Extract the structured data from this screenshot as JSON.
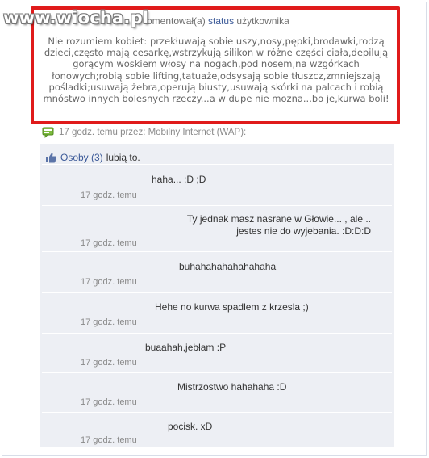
{
  "watermark": "www.wiocha.pl",
  "status": {
    "header_prefix": "omentował(a)",
    "header_link": "status",
    "header_suffix": "użytkownika",
    "text": "Nie rozumiem kobiet: przekłuwają sobie uszy,nosy,pępki,brodawki,rodzą dzieci,często mają cesarkę,wstrzykują silikon w różne części ciała,depilują gorącym woskiem włosy na nogach,pod nosem,na wzgórkach łonowych;robią sobie lifting,tatuaże,odsysają sobie tłuszcz,zmniejszają pośladki;usuwają żebra,operują biusty,usuwają skórki na palcach i robią mnóstwo innych bolesnych rzeczy...a w dupe nie można...bo je,kurwa boli!"
  },
  "meta": {
    "text": "17 godz. temu przez: Mobilny Internet (WAP):"
  },
  "likes": {
    "link": "Osoby (3)",
    "text": "lubią to."
  },
  "comments": [
    {
      "text": "haha... ;D ;D",
      "time": "17 godz. temu"
    },
    {
      "text": "Ty jednak masz nasrane w Głowie... , ale ..\njestes nie do wyjebania. :D:D:D",
      "time": "17 godz. temu"
    },
    {
      "text": "buhahahahahahahaha",
      "time": "17 godz. temu"
    },
    {
      "text": "Hehe no kurwa spadlem z krzesla ;)",
      "time": "17 godz. temu"
    },
    {
      "text": "buaahah,jebłam :P",
      "time": "17 godz. temu"
    },
    {
      "text": "Mistrzostwo hahahaha :D",
      "time": "17 godz. temu"
    },
    {
      "text": "pocisk. xD",
      "time": "17 godz. temu"
    }
  ],
  "colors": {
    "highlight_border": "#e01b1b",
    "link": "#3b5998",
    "feedback_bg": "#edeff4"
  }
}
